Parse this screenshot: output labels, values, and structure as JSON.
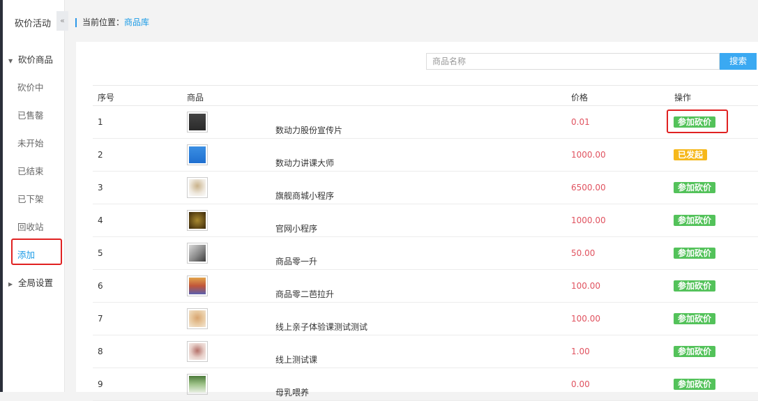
{
  "sidebar": {
    "title": "砍价活动",
    "collapse_glyph": "«",
    "group1": {
      "label": "砍价商品",
      "icon": "caret-down-icon"
    },
    "items": [
      {
        "label": "砍价中"
      },
      {
        "label": "已售罄"
      },
      {
        "label": "未开始"
      },
      {
        "label": "已结束"
      },
      {
        "label": "已下架"
      },
      {
        "label": "回收站"
      },
      {
        "label": "添加",
        "active": true
      }
    ],
    "group2": {
      "label": "全局设置",
      "icon": "caret-right-icon"
    }
  },
  "breadcrumb": {
    "prefix": "当前位置：",
    "current": "商品库"
  },
  "search": {
    "placeholder": "商品名称",
    "button_label": "搜索"
  },
  "table": {
    "headers": {
      "index": "序号",
      "product": "商品",
      "price": "价格",
      "action": "操作"
    },
    "rows": [
      {
        "index": "1",
        "name": "数动力股份宣传片",
        "price": "0.01",
        "action": "参加砍价"
      },
      {
        "index": "2",
        "name": "数动力讲课大师",
        "price": "1000.00",
        "action": "已发起"
      },
      {
        "index": "3",
        "name": "旗舰商城小程序",
        "price": "6500.00",
        "action": "参加砍价"
      },
      {
        "index": "4",
        "name": "官网小程序",
        "price": "1000.00",
        "action": "参加砍价"
      },
      {
        "index": "5",
        "name": "商品零一升",
        "price": "50.00",
        "action": "参加砍价"
      },
      {
        "index": "6",
        "name": "商品零二芭拉升",
        "price": "100.00",
        "action": "参加砍价"
      },
      {
        "index": "7",
        "name": "线上亲子体验课测试测试",
        "price": "100.00",
        "action": "参加砍价"
      },
      {
        "index": "8",
        "name": "线上测试课",
        "price": "1.00",
        "action": "参加砍价"
      },
      {
        "index": "9",
        "name": "母乳喂养",
        "price": "0.00",
        "action": "参加砍价"
      }
    ]
  },
  "colors": {
    "accent": "#1a9be6",
    "price": "#e0525f",
    "join": "#53c25a",
    "launched": "#f6b81b",
    "highlight": "#e02121"
  }
}
